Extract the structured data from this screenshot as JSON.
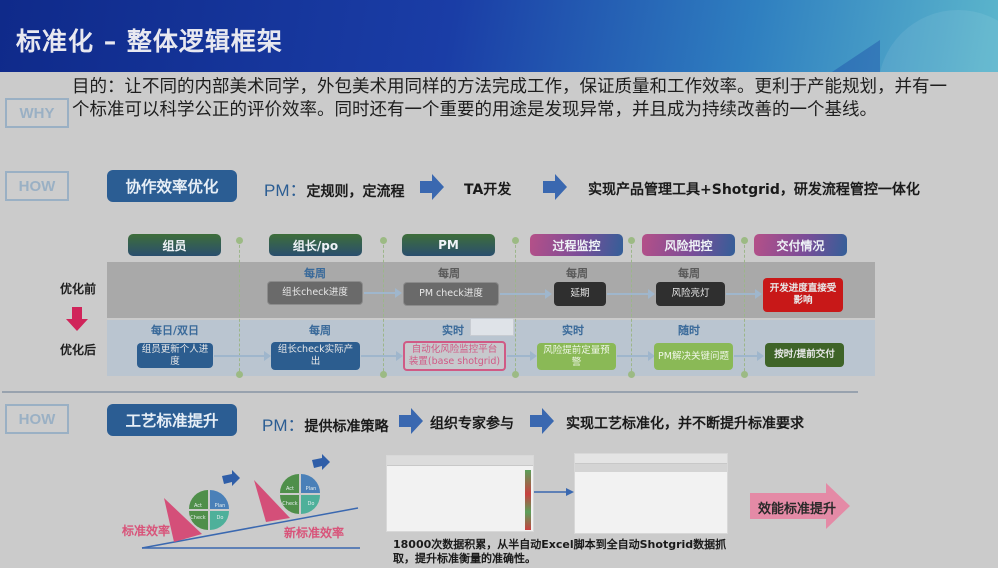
{
  "header": {
    "title": "标准化 – 整体逻辑框架"
  },
  "why": {
    "tag": "WHY",
    "text": "目的：让不同的内部美术同学，外包美术用同样的方法完成工作，保证质量和工作效率。更利于产能规划，并有一个标准可以科学公正的评价效率。同时还有一个重要的用途是发现异常，并且成为持续改善的一个基线。"
  },
  "how1": {
    "tag": "HOW",
    "button": "协作效率优化",
    "pm_prefix": "PM：",
    "pm_text": "定规则，定流程",
    "step2": "TA开发",
    "step3": "实现产品管理工具+Shotgrid，研发流程管控一体化"
  },
  "diagram": {
    "before_label": "优化前",
    "after_label": "优化后",
    "stages": [
      {
        "label": "组员",
        "style": "green"
      },
      {
        "label": "组长/po",
        "style": "green"
      },
      {
        "label": "PM",
        "style": "green"
      },
      {
        "label": "过程监控",
        "style": "purple"
      },
      {
        "label": "风险把控",
        "style": "purple"
      },
      {
        "label": "交付情况",
        "style": "purple"
      }
    ],
    "before": [
      {
        "freq": "",
        "box": ""
      },
      {
        "freq": "每周",
        "box": "组长check进度"
      },
      {
        "freq": "每周",
        "box": "PM check进度"
      },
      {
        "freq": "每周",
        "box": "延期"
      },
      {
        "freq": "每周",
        "box": "风险亮灯"
      },
      {
        "freq": "",
        "box": "开发进度直接受影响"
      }
    ],
    "after": [
      {
        "freq": "每日/双日",
        "box": "组员更新个人进度"
      },
      {
        "freq": "每周",
        "box": "组长check实际产出"
      },
      {
        "freq": "实时",
        "box": "自动化风险监控平台装置(base shotgrid)"
      },
      {
        "freq": "实时",
        "box": "风险提前定量预警"
      },
      {
        "freq": "随时",
        "box": "PM解决关键问题"
      },
      {
        "freq": "",
        "box": "按时/提前交付"
      }
    ]
  },
  "how2": {
    "tag": "HOW",
    "button": "工艺标准提升",
    "pm_prefix": "PM：",
    "pm_text": "提供标准策略",
    "step2": "组织专家参与",
    "step3": "实现工艺标准化，并不断提升标准要求"
  },
  "pdca": {
    "left_label": "标准效率",
    "right_label": "新标准效率",
    "quadrants": [
      "Act",
      "Plan",
      "Check",
      "Do"
    ]
  },
  "data_caption": "18000次数据积累，从半自动Excel脚本到全自动Shotgrid数据抓取，提升标准衡量的准确性。",
  "result_arrow": "效能标准提升",
  "colors": {
    "primary_blue": "#2b5d93",
    "pink": "#d8547a",
    "red": "#c81818",
    "light_green": "#8ab956",
    "dark_green": "#3f6428"
  }
}
